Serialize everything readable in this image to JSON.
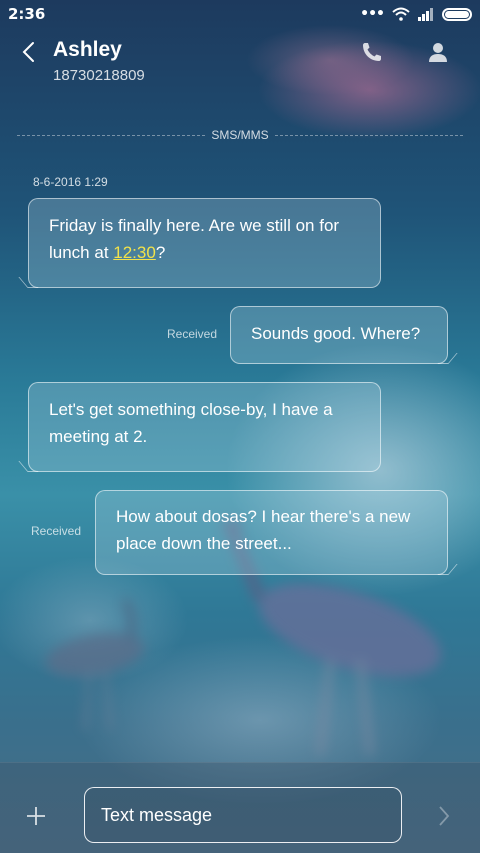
{
  "status_bar": {
    "time": "2:36",
    "icons": [
      "more-dots-icon",
      "wifi-icon",
      "signal-icon",
      "battery-icon"
    ]
  },
  "header": {
    "contact_name": "Ashley",
    "contact_number": "18730218809",
    "icons": [
      "back-icon",
      "call-icon",
      "profile-icon"
    ]
  },
  "thread": {
    "channel": "SMS/MMS",
    "date": "8-6-2016 1:29",
    "messages": [
      {
        "direction": "incoming",
        "text_before_time": "Friday is finally here. Are we still on for lunch at ",
        "time_link": "12:30",
        "text_after_time": "?"
      },
      {
        "direction": "outgoing",
        "status": "Received",
        "text": "Sounds good. Where?"
      },
      {
        "direction": "incoming",
        "text": "Let's get something close-by, I have a meeting at 2."
      },
      {
        "direction": "outgoing",
        "status": "Received",
        "text": "How about dosas? I hear there's a new place down the street..."
      }
    ]
  },
  "composer": {
    "placeholder": "Text message",
    "icons": [
      "add-icon",
      "send-icon"
    ]
  },
  "colors": {
    "link_highlight": "#f2e24a",
    "bubble_border": "#ffffff"
  }
}
